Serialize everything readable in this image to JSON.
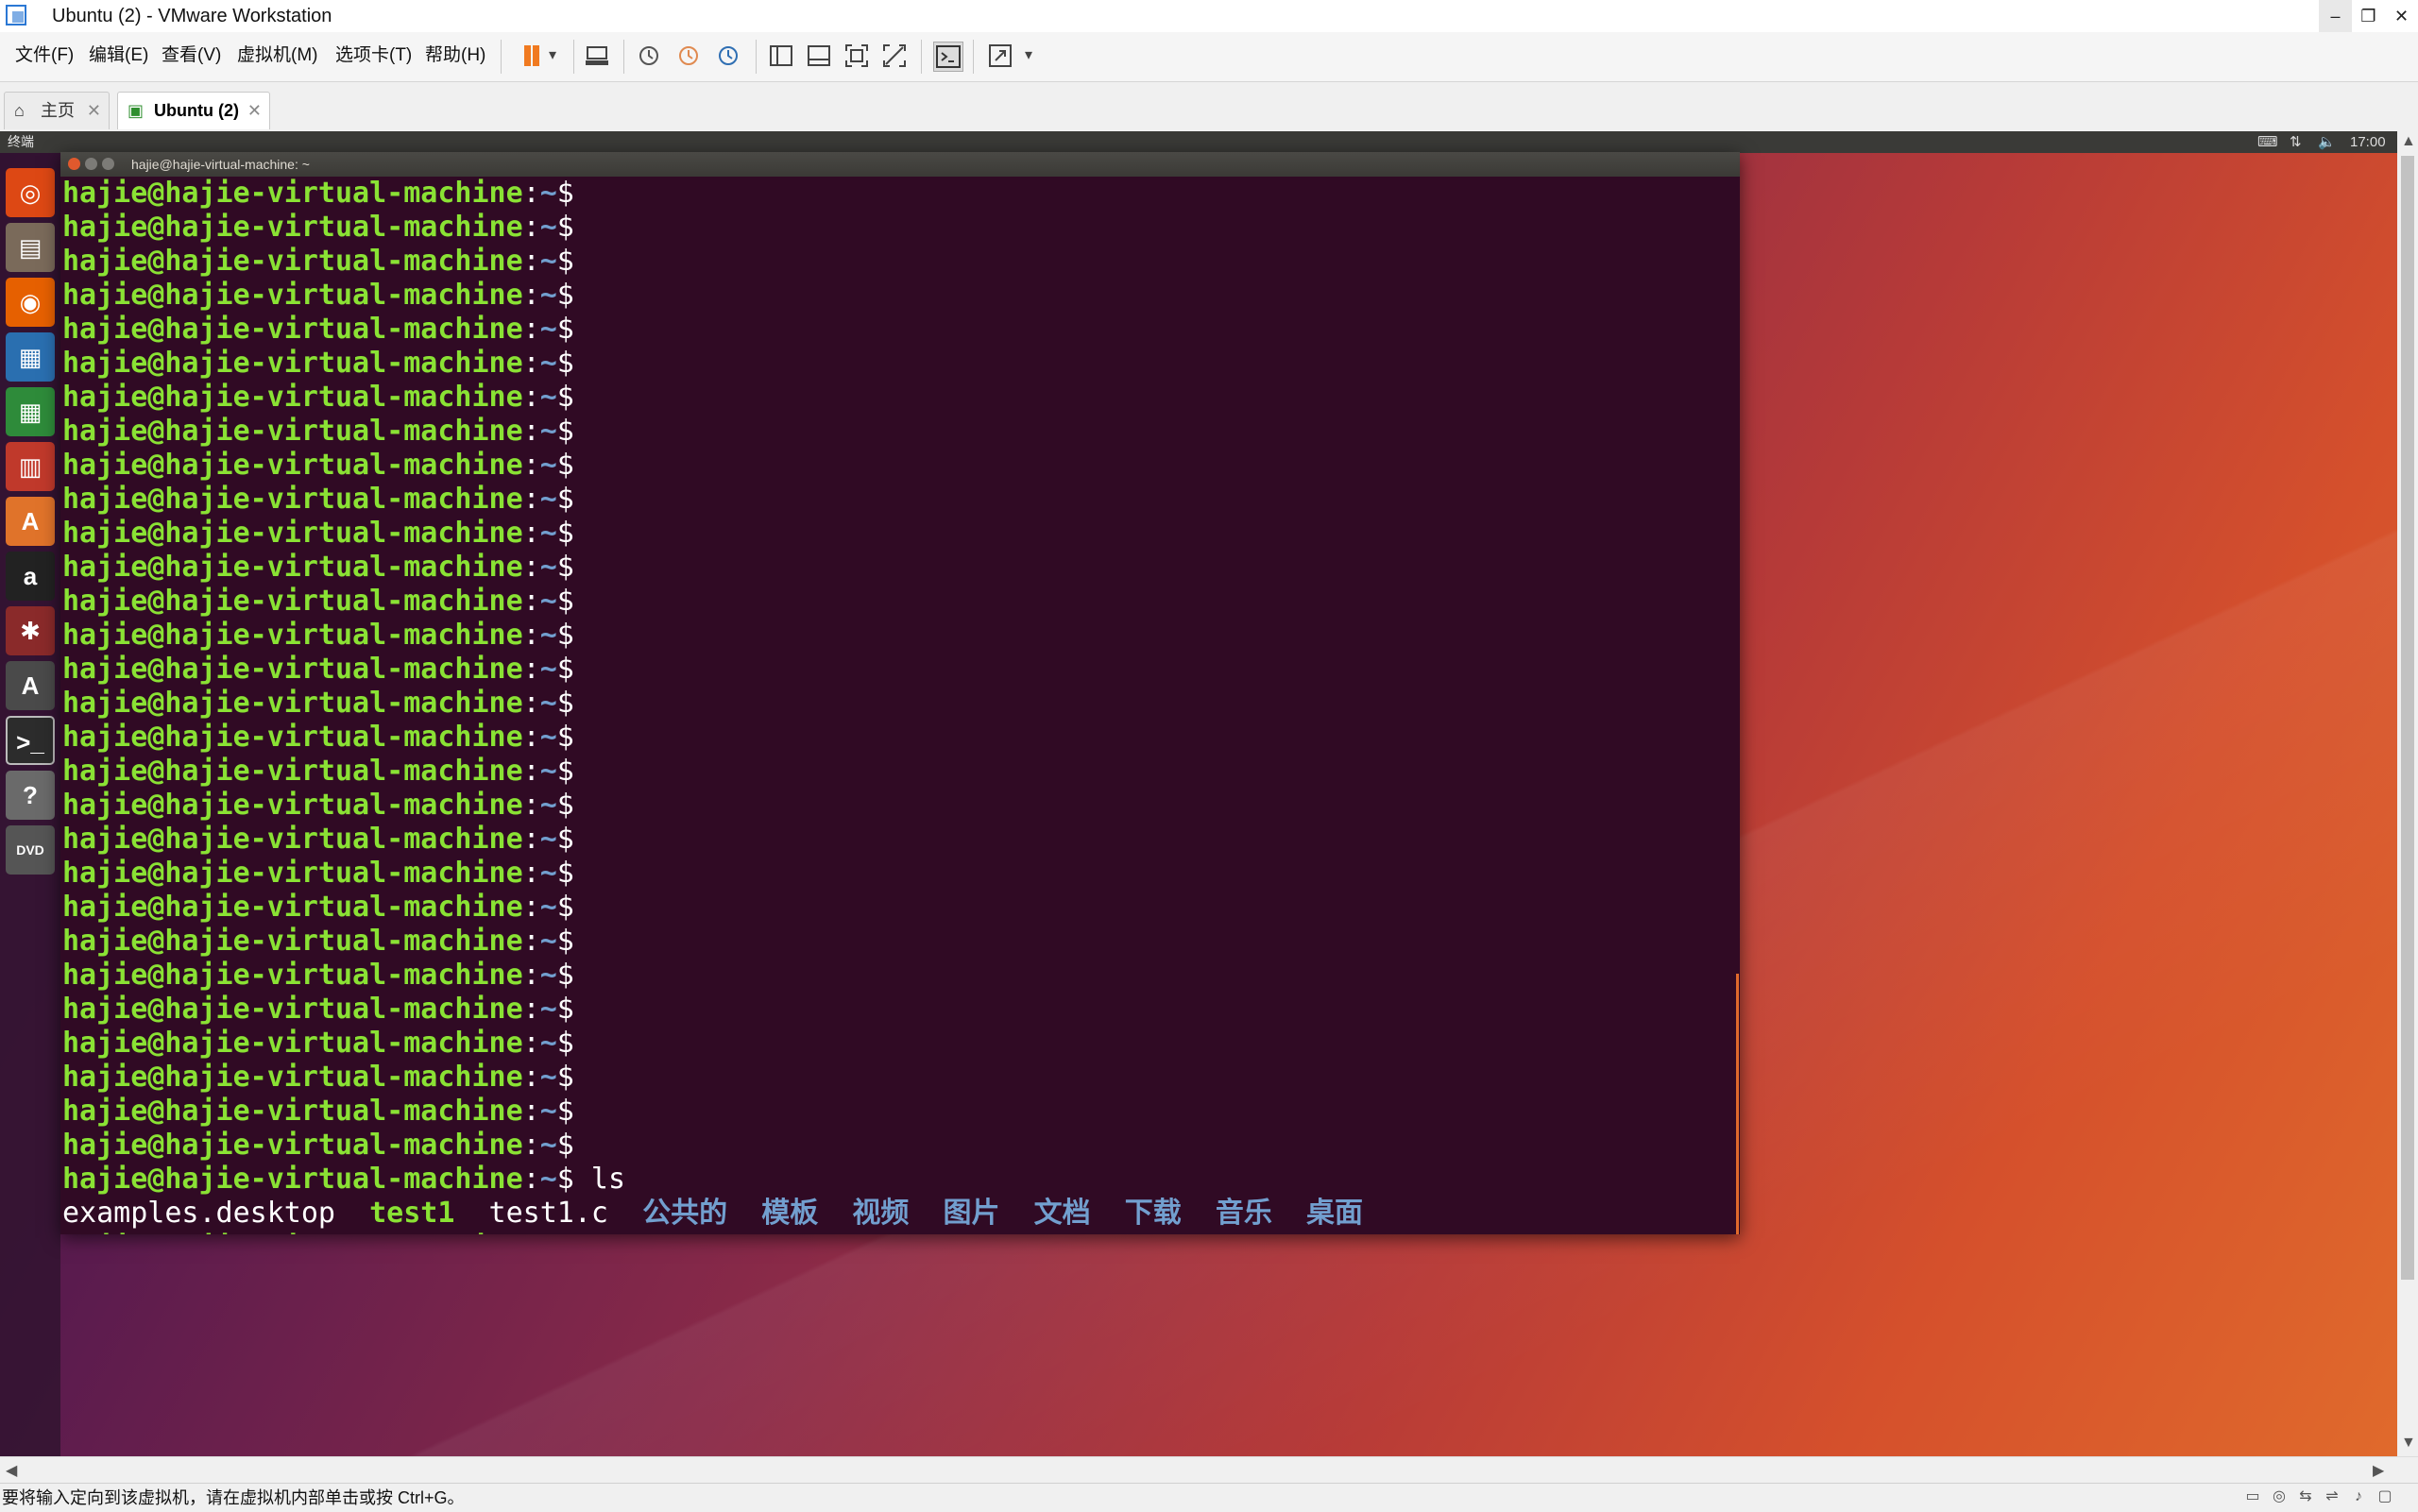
{
  "window": {
    "title": "Ubuntu (2) - VMware Workstation",
    "min": "–",
    "max": "❐",
    "close": "✕"
  },
  "menu": [
    "文件(F)",
    "编辑(E)",
    "查看(V)",
    "虚拟机(M)",
    "选项卡(T)",
    "帮助(H)"
  ],
  "toolbar": {
    "icons": [
      "pause-icon",
      "dropdown-icon",
      "send-ctrl-alt-del-icon",
      "snapshot-icon",
      "revert-snapshot-icon",
      "snapshot-manager-icon",
      "sidebar-icon",
      "thumbnail-icon",
      "fullscreen-icon",
      "unity-icon",
      "console-icon",
      "stretch-icon"
    ],
    "dropdown": "▾",
    "pause_color": "#f07a20"
  },
  "tabs": [
    {
      "label": "主页",
      "icon": "home-icon",
      "close": "✕"
    },
    {
      "label": "Ubuntu (2)",
      "icon": "vm-icon",
      "close": "✕"
    }
  ],
  "guest": {
    "topbar_label": "终端",
    "time": "17:00",
    "tray_icons": [
      "keyboard-icon",
      "network-icon",
      "volume-icon"
    ],
    "launcher": [
      "ubuntu-dash-icon",
      "files-icon",
      "firefox-icon",
      "writer-icon",
      "calc-icon",
      "impress-icon",
      "software-center-icon",
      "amazon-icon",
      "system-settings-icon",
      "software-updater-icon",
      "terminal-icon",
      "help-icon",
      "dvd-icon"
    ],
    "launcher_glyphs": [
      "◎",
      "▤",
      "◉",
      "▦",
      "▦",
      "▥",
      "A",
      "a",
      "✱",
      "A",
      ">_",
      "?",
      "DVD"
    ]
  },
  "terminal": {
    "title": "hajie@hajie-virtual-machine: ~",
    "prompt_user": "hajie@hajie-virtual-machine",
    "prompt_sep": ":",
    "prompt_dir": "~",
    "prompt_end": "$",
    "empty_prompt_count": 29,
    "command": " ls",
    "ls_files": [
      "examples.desktop",
      "test1",
      "test1.c"
    ],
    "ls_dirs": [
      "公共的",
      "模板",
      "视频",
      "图片",
      "文档",
      "下载",
      "音乐",
      "桌面"
    ],
    "prompt_color": "#8ae234",
    "dir_color": "#729fcf",
    "background": "#300a24"
  },
  "status": {
    "text": "要将输入定向到该虚拟机，请在虚拟机内部单击或按 Ctrl+G。"
  }
}
